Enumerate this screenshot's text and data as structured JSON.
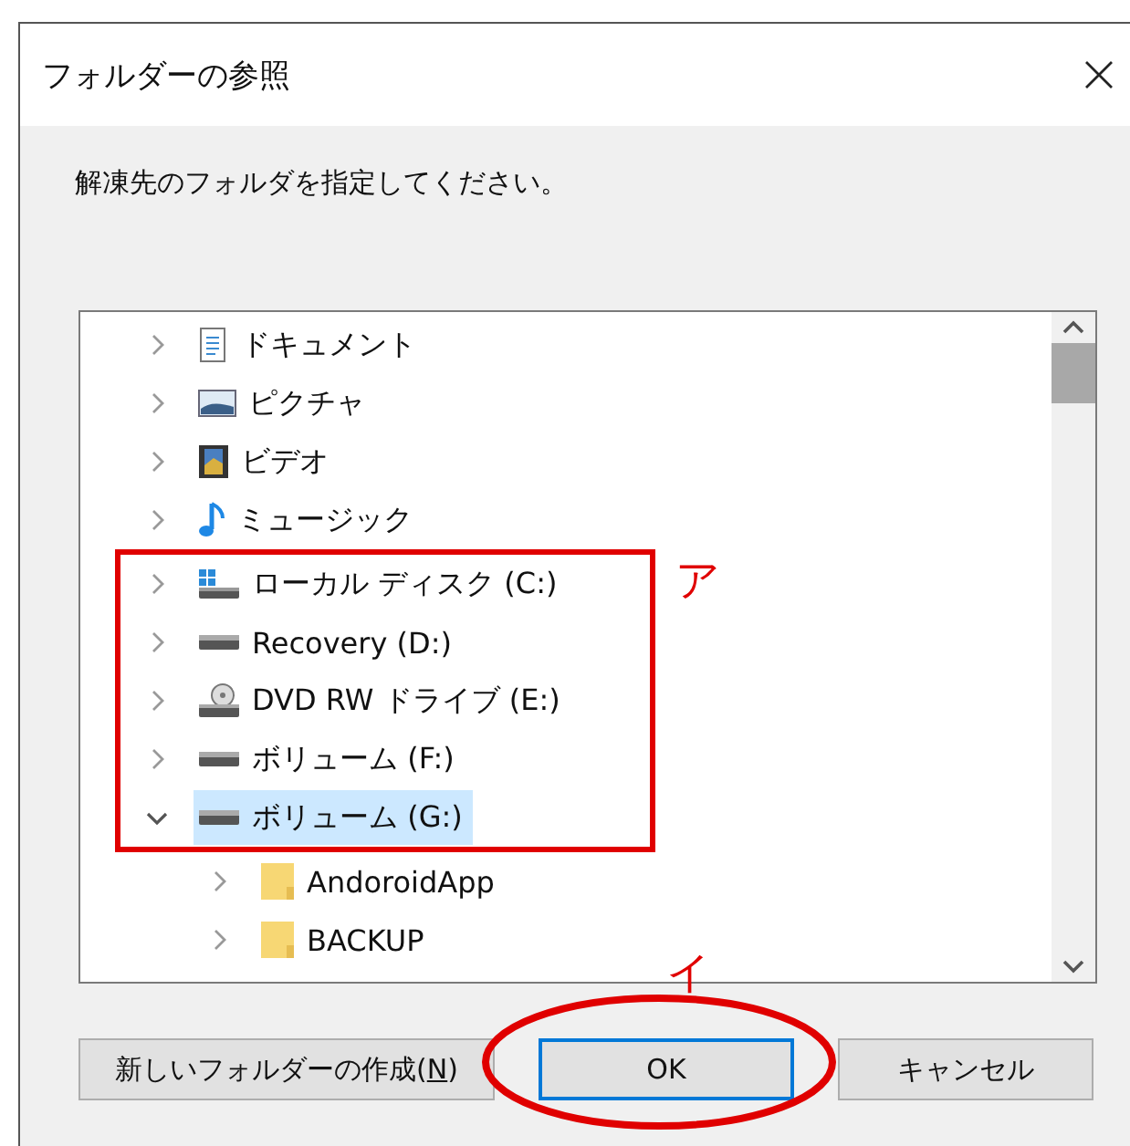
{
  "window": {
    "title": "フォルダーの参照"
  },
  "message": "解凍先のフォルダを指定してください。",
  "tree": [
    {
      "label": "ドキュメント",
      "kind": "document",
      "expanded": false,
      "selected": false,
      "boxed": false
    },
    {
      "label": "ピクチャ",
      "kind": "picture",
      "expanded": false,
      "selected": false,
      "boxed": false
    },
    {
      "label": "ビデオ",
      "kind": "video",
      "expanded": false,
      "selected": false,
      "boxed": false
    },
    {
      "label": "ミュージック",
      "kind": "music",
      "expanded": false,
      "selected": false,
      "boxed": false
    },
    {
      "label": "ローカル ディスク (C:)",
      "kind": "system-drive",
      "expanded": false,
      "selected": false,
      "boxed": true
    },
    {
      "label": "Recovery (D:)",
      "kind": "drive",
      "expanded": false,
      "selected": false,
      "boxed": true
    },
    {
      "label": "DVD RW ドライブ (E:)",
      "kind": "dvd",
      "expanded": false,
      "selected": false,
      "boxed": true
    },
    {
      "label": "ボリューム (F:)",
      "kind": "drive",
      "expanded": false,
      "selected": false,
      "boxed": true
    },
    {
      "label": "ボリューム (G:)",
      "kind": "drive",
      "expanded": true,
      "selected": true,
      "boxed": true,
      "children": [
        {
          "label": "AndoroidApp",
          "kind": "folder",
          "expanded": false,
          "selected": false
        },
        {
          "label": "BACKUP",
          "kind": "folder",
          "expanded": false,
          "selected": false
        }
      ]
    }
  ],
  "box_label": "ア",
  "buttons": [
    {
      "label": "新しいフォルダーの作成(",
      "mnemonic": "N",
      "after": ")",
      "default": false,
      "circled": false
    },
    {
      "label": "OK",
      "default": true,
      "circled": true,
      "circle_label": "イ"
    },
    {
      "label": "キャンセル",
      "default": false,
      "circled": false
    }
  ]
}
